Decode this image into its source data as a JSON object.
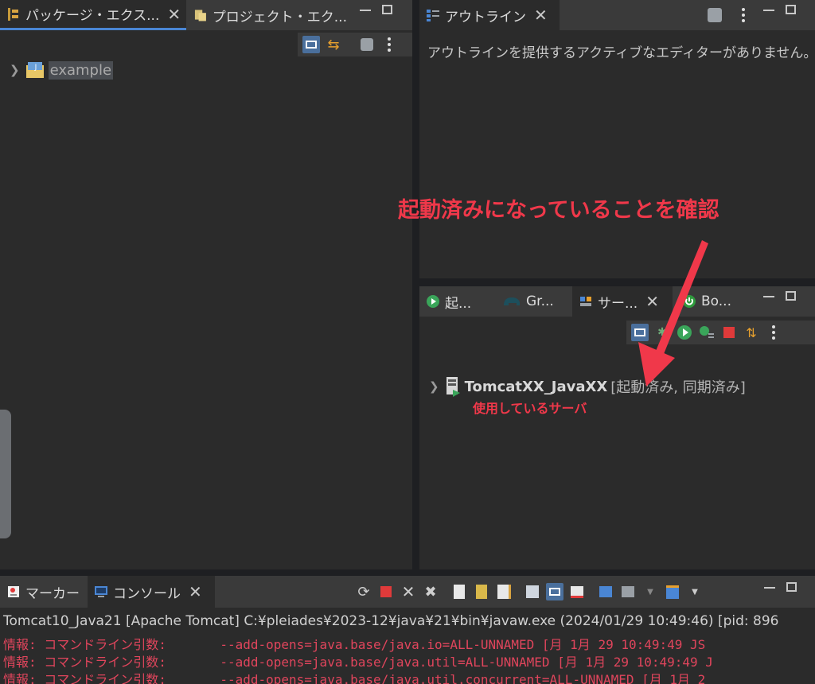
{
  "left_panel": {
    "tabs": [
      {
        "label": "パッケージ・エクス...",
        "icon": "package-explorer-icon"
      },
      {
        "label": "プロジェクト・エク...",
        "icon": "project-explorer-icon"
      }
    ],
    "tree": [
      {
        "label": "example",
        "icon": "project-folder-icon"
      }
    ]
  },
  "outline_panel": {
    "tab_label": "アウトライン",
    "message": "アウトラインを提供するアクティブなエディターがありません。"
  },
  "servers_panel": {
    "tabs": [
      {
        "label": "起...",
        "icon": "run-icon"
      },
      {
        "label": "Gr...",
        "icon": "gradle-elephant-icon"
      },
      {
        "label": "サー...",
        "icon": "servers-icon"
      },
      {
        "label": "Bo...",
        "icon": "boot-power-icon"
      }
    ],
    "server_name": "TomcatXX_JavaXX",
    "server_status": "[起動済み, 同期済み]"
  },
  "annotations": {
    "confirm_started": "起動済みになっていることを確認",
    "server_in_use": "使用しているサーバ"
  },
  "bottom_panel": {
    "tabs": [
      {
        "label": "マーカー",
        "icon": "markers-icon"
      },
      {
        "label": "コンソール",
        "icon": "console-icon"
      }
    ],
    "console_header": "Tomcat10_Java21 [Apache Tomcat] C:¥pleiades¥2023-12¥java¥21¥bin¥javaw.exe  (2024/01/29 10:49:46) [pid: 896",
    "console_lines": [
      "情報: コマンドライン引数:       --add-opens=java.base/java.io=ALL-UNNAMED [月 1月 29 10:49:49 JS",
      "情報: コマンドライン引数:       --add-opens=java.base/java.util=ALL-UNNAMED [月 1月 29 10:49:49 J",
      "情報: コマンドライン引数:       --add-opens=java.base/java.util.concurrent=ALL-UNNAMED [月 1月 2"
    ]
  },
  "colors": {
    "accent": "#4a86d4",
    "annotation": "#f0384a",
    "console_error": "#e0455c"
  }
}
